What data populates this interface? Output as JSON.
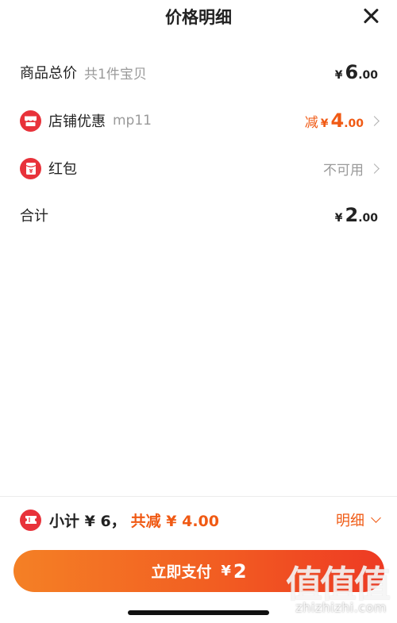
{
  "header": {
    "title": "价格明细"
  },
  "rows": {
    "total": {
      "label": "商品总价",
      "sub": "共1件宝贝",
      "currency": "¥",
      "int": "6",
      "dec": ".00"
    },
    "shop_discount": {
      "icon": "shop-icon",
      "label": "店铺优惠",
      "sub": "mp11",
      "prefix": "减",
      "currency": "¥",
      "int": "4",
      "dec": ".00"
    },
    "red_packet": {
      "icon": "red-packet-icon",
      "label": "红包",
      "status": "不可用"
    },
    "sum": {
      "label": "合计",
      "currency": "¥",
      "int": "2",
      "dec": ".00"
    }
  },
  "summary": {
    "icon": "coupon-ticket-icon",
    "subtotal": "小计 ¥ 6，",
    "saved": "共减 ¥ 4.00",
    "detail": "明细"
  },
  "pay": {
    "label": "立即支付",
    "currency": "¥",
    "amount": "2"
  },
  "watermark": {
    "text": "值值值",
    "url": "zhizhizhi.com"
  },
  "colors": {
    "accent": "#f05a14",
    "icon_red": "#e8323a",
    "button_start": "#f48025",
    "button_end": "#ee3a23"
  }
}
